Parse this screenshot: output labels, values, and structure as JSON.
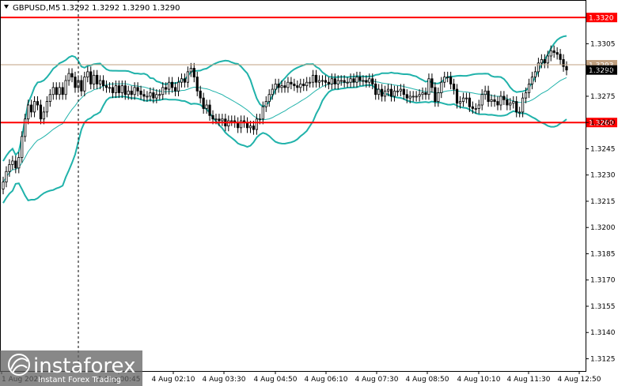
{
  "header": {
    "symbol_label": "GBPUSD,M5",
    "ohlc_label": "1.3292 1.3292 1.3290 1.3290",
    "menu_icon": "triangle-down-icon"
  },
  "watermark": {
    "brand": "instaforex",
    "tagline": "Instant Forex Trading",
    "logo_icon": "instaforex-logo-icon"
  },
  "colors": {
    "candle": "#000000",
    "bollinger": "#20b2aa",
    "support_resistance": "#ff0000",
    "current_price_line": "#c0a080",
    "price_tag_bg": "#000000",
    "level_tag_bg": "#ff0000"
  },
  "chart_data": {
    "type": "candlestick",
    "symbol": "GBPUSD",
    "timeframe": "M5",
    "ylim": [
      1.3118,
      1.333
    ],
    "y_ticks": [
      "1.3305",
      "1.3290",
      "1.3275",
      "1.3260",
      "1.3245",
      "1.3230",
      "1.3215",
      "1.3200",
      "1.3185",
      "1.3170",
      "1.3155",
      "1.3140",
      "1.3125"
    ],
    "x_ticks": [
      "1 Aug 2025",
      "4 Aug 00:45",
      "4 Aug 02:10",
      "4 Aug 03:30",
      "4 Aug 04:50",
      "4 Aug 06:10",
      "4 Aug 07:30",
      "4 Aug 08:50",
      "4 Aug 10:10",
      "4 Aug 11:30",
      "4 Aug 12:50"
    ],
    "levels": [
      {
        "value": 1.332,
        "label": "1.3320",
        "kind": "resistance"
      },
      {
        "value": 1.326,
        "label": "1.3260",
        "kind": "support"
      }
    ],
    "current_price": {
      "value": 1.329,
      "label": "1.3290"
    },
    "bid_line": {
      "value": 1.3293,
      "label": "1.3293"
    },
    "closes": [
      1.3226,
      1.3232,
      1.3236,
      1.3238,
      1.3234,
      1.324,
      1.3252,
      1.3262,
      1.327,
      1.3266,
      1.3272,
      1.327,
      1.3262,
      1.3266,
      1.3272,
      1.3276,
      1.328,
      1.3276,
      1.328,
      1.3276,
      1.3284,
      1.3288,
      1.3286,
      1.328,
      1.3284,
      1.3278,
      1.3286,
      1.3289,
      1.3282,
      1.3287,
      1.3282,
      1.3284,
      1.3281,
      1.328,
      1.328,
      1.3277,
      1.3281,
      1.3277,
      1.3281,
      1.3276,
      1.3278,
      1.3276,
      1.328,
      1.3278,
      1.3276,
      1.3275,
      1.3275,
      1.3277,
      1.3274,
      1.3276,
      1.3276,
      1.328,
      1.3279,
      1.3283,
      1.328,
      1.3278,
      1.3283,
      1.3285,
      1.3283,
      1.3289,
      1.3291,
      1.3286,
      1.3278,
      1.3274,
      1.3268,
      1.327,
      1.3264,
      1.3262,
      1.3262,
      1.3261,
      1.3262,
      1.3258,
      1.3261,
      1.3261,
      1.326,
      1.3257,
      1.3261,
      1.326,
      1.3257,
      1.3258,
      1.3256,
      1.3262,
      1.3262,
      1.3269,
      1.3272,
      1.3276,
      1.3279,
      1.3282,
      1.328,
      1.3281,
      1.328,
      1.3283,
      1.3282,
      1.3281,
      1.328,
      1.3282,
      1.3281,
      1.3283,
      1.3283,
      1.3287,
      1.3283,
      1.3284,
      1.3284,
      1.3283,
      1.3282,
      1.3285,
      1.3282,
      1.3284,
      1.3284,
      1.3283,
      1.3283,
      1.3285,
      1.3283,
      1.3286,
      1.3284,
      1.3284,
      1.3283,
      1.3285,
      1.3282,
      1.3276,
      1.3279,
      1.3275,
      1.3278,
      1.3279,
      1.3275,
      1.3278,
      1.3278,
      1.3279,
      1.3276,
      1.3274,
      1.3275,
      1.3275,
      1.3275,
      1.3276,
      1.3277,
      1.3276,
      1.3285,
      1.328,
      1.3272,
      1.3277,
      1.3283,
      1.3286,
      1.3286,
      1.3282,
      1.3279,
      1.3271,
      1.3272,
      1.3274,
      1.3274,
      1.3269,
      1.3268,
      1.3268,
      1.327,
      1.3276,
      1.3278,
      1.3272,
      1.3273,
      1.3272,
      1.327,
      1.3275,
      1.3273,
      1.327,
      1.3271,
      1.3272,
      1.3266,
      1.3266,
      1.3274,
      1.3277,
      1.3282,
      1.3286,
      1.3289,
      1.3294,
      1.3296,
      1.3294,
      1.3298,
      1.3301,
      1.33,
      1.3299,
      1.3296,
      1.3292,
      1.329
    ]
  }
}
